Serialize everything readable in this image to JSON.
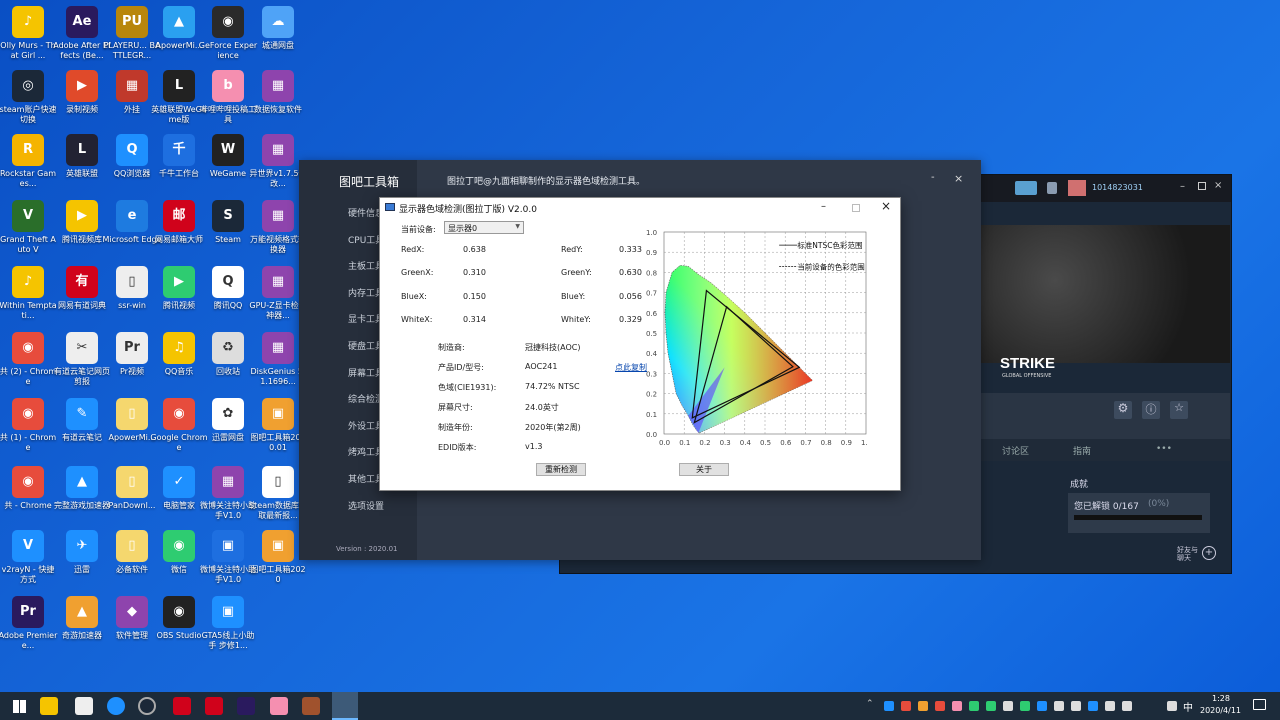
{
  "desktop_icons": [
    {
      "label": "Olly Murs - That Girl ...",
      "color": "#f5c400",
      "glyph": "♪"
    },
    {
      "label": "Adobe After Effects (Be...",
      "color": "#2a1a5e",
      "glyph": "Ae"
    },
    {
      "label": "PLAYERU... BATTLEGR...",
      "color": "#b8860b",
      "glyph": "PU"
    },
    {
      "label": "ApowerMi...",
      "color": "#2aa0f0",
      "glyph": "▲"
    },
    {
      "label": "GeForce Experience",
      "color": "#2a2a2a",
      "glyph": "◉"
    },
    {
      "label": "城通网盘",
      "color": "#4fa3f7",
      "glyph": "☁"
    },
    {
      "label": "steam账户快速切换",
      "color": "#1b2838",
      "glyph": "◎"
    },
    {
      "label": "录制视频",
      "color": "#e04a2a",
      "glyph": "▶"
    },
    {
      "label": "外挂",
      "color": "#c0392b",
      "glyph": "▦"
    },
    {
      "label": "英雄联盟WeGame版",
      "color": "#222",
      "glyph": "L"
    },
    {
      "label": "哔哩哔哩投稿工具",
      "color": "#f58fb0",
      "glyph": "b"
    },
    {
      "label": "数据恢复软件",
      "color": "#8e44ad",
      "glyph": "▦"
    },
    {
      "label": "Rockstar Games...",
      "color": "#f5b400",
      "glyph": "R"
    },
    {
      "label": "英雄联盟",
      "color": "#223",
      "glyph": "L"
    },
    {
      "label": "QQ浏览器",
      "color": "#1e90ff",
      "glyph": "Q"
    },
    {
      "label": "千牛工作台",
      "color": "#1e6fe0",
      "glyph": "千"
    },
    {
      "label": "WeGame",
      "color": "#222",
      "glyph": "W"
    },
    {
      "label": "异世界v1.7.5修改...",
      "color": "#8e44ad",
      "glyph": "▦"
    },
    {
      "label": "Grand Theft Auto V",
      "color": "#2a6e2a",
      "glyph": "V"
    },
    {
      "label": "腾讯视频库",
      "color": "#f5c400",
      "glyph": "▶"
    },
    {
      "label": "Microsoft Edge",
      "color": "#1e7be0",
      "glyph": "e"
    },
    {
      "label": "网易邮箱大师",
      "color": "#d0021b",
      "glyph": "邮"
    },
    {
      "label": "Steam",
      "color": "#1b2838",
      "glyph": "S"
    },
    {
      "label": "万能视频格式转换器",
      "color": "#8e44ad",
      "glyph": "▦"
    },
    {
      "label": "Within Temptati...",
      "color": "#f5c400",
      "glyph": "♪"
    },
    {
      "label": "网易有道词典",
      "color": "#d0021b",
      "glyph": "有"
    },
    {
      "label": "ssr-win",
      "color": "#eee",
      "glyph": "▯"
    },
    {
      "label": "腾讯视频",
      "color": "#2ecc71",
      "glyph": "▶"
    },
    {
      "label": "腾讯QQ",
      "color": "#fff",
      "glyph": "Q"
    },
    {
      "label": "GPU-Z显卡检测神器...",
      "color": "#8e44ad",
      "glyph": "▦"
    },
    {
      "label": "共 (2) - Chrome",
      "color": "#e74c3c",
      "glyph": "◉"
    },
    {
      "label": "有道云笔记网页剪报",
      "color": "#eee",
      "glyph": "✂"
    },
    {
      "label": "Pr视频",
      "color": "#eee",
      "glyph": "Pr"
    },
    {
      "label": "QQ音乐",
      "color": "#f5c400",
      "glyph": "♫"
    },
    {
      "label": "回收站",
      "color": "#ddd",
      "glyph": "♻"
    },
    {
      "label": "DiskGenius 5.1.1696...",
      "color": "#8e44ad",
      "glyph": "▦"
    },
    {
      "label": "共 (1) - Chrome",
      "color": "#e74c3c",
      "glyph": "◉"
    },
    {
      "label": "有道云笔记",
      "color": "#1e90ff",
      "glyph": "✎"
    },
    {
      "label": "ApowerMi...",
      "color": "#f5d76e",
      "glyph": "▯"
    },
    {
      "label": "Google Chrome",
      "color": "#e74c3c",
      "glyph": "◉"
    },
    {
      "label": "迅雷网盘",
      "color": "#fff",
      "glyph": "✿"
    },
    {
      "label": "图吧工具箱2020.01",
      "color": "#f0a030",
      "glyph": "▣"
    },
    {
      "label": "共 - Chrome",
      "color": "#e74c3c",
      "glyph": "◉"
    },
    {
      "label": "完整游戏加速器",
      "color": "#1e90ff",
      "glyph": "▲"
    },
    {
      "label": "PanDownl...",
      "color": "#f5d76e",
      "glyph": "▯"
    },
    {
      "label": "电脑管家",
      "color": "#1e90ff",
      "glyph": "✓"
    },
    {
      "label": "微博关注特小助手V1.0",
      "color": "#8e44ad",
      "glyph": "▦"
    },
    {
      "label": "Steam数据库获取最新报...",
      "color": "#fff",
      "glyph": "▯"
    },
    {
      "label": "v2rayN - 快捷方式",
      "color": "#1e90ff",
      "glyph": "V"
    },
    {
      "label": "迅雷",
      "color": "#1e90ff",
      "glyph": "✈"
    },
    {
      "label": "必备软件",
      "color": "#f5d76e",
      "glyph": "▯"
    },
    {
      "label": "微信",
      "color": "#2ecc71",
      "glyph": "◉"
    },
    {
      "label": "微博关注特小助手V1.0",
      "color": "#1e6fe0",
      "glyph": "▣"
    },
    {
      "label": "图吧工具箱2020",
      "color": "#f0a030",
      "glyph": "▣"
    },
    {
      "label": "Adobe Premiere...",
      "color": "#2a1a5e",
      "glyph": "Pr"
    },
    {
      "label": "奇游加速器",
      "color": "#f0a030",
      "glyph": "▲"
    },
    {
      "label": "软件管理",
      "color": "#8e44ad",
      "glyph": "◆"
    },
    {
      "label": "OBS Studio",
      "color": "#222",
      "glyph": "◉"
    },
    {
      "label": "GTA5线上小助手 步修1...",
      "color": "#1e90ff",
      "glyph": "▣"
    }
  ],
  "steam": {
    "username": "1014823031",
    "game_logo": "STRIKE",
    "game_sub": "GLOBAL OFFENSIVE",
    "tab_discussion": "讨论区",
    "tab_guide": "指南",
    "tab_more": "•••",
    "achievements_title": "成就",
    "achievements_text": "您已解锁 0/167",
    "achievements_pct": "(0%)",
    "achievements_progress": 0,
    "friends_label": "好友与聊天"
  },
  "toolbox": {
    "title": "图吧工具箱",
    "header": "图拉丁吧@九面相聊制作的显示器色域检测工具。",
    "nav": [
      "硬件信息",
      "CPU工具",
      "主板工具",
      "内存工具",
      "显卡工具",
      "硬盘工具",
      "屏幕工具",
      "综合检测",
      "外设工具",
      "烤鸡工具",
      "其他工具",
      "选项设置"
    ],
    "version": "Version : 2020.01",
    "min_label": "-",
    "close_label": "×"
  },
  "dialog": {
    "title": "显示器色域检测(图拉丁版) V2.0.0",
    "device_label": "当前设备:",
    "device_value": "显示器0",
    "redx_label": "RedX:",
    "redx": "0.638",
    "redy_label": "RedY:",
    "redy": "0.333",
    "greenx_label": "GreenX:",
    "greenx": "0.310",
    "greeny_label": "GreenY:",
    "greeny": "0.630",
    "bluex_label": "BlueX:",
    "bluex": "0.150",
    "bluey_label": "BlueY:",
    "bluey": "0.056",
    "whitex_label": "WhiteX:",
    "whitex": "0.314",
    "whitey_label": "WhiteY:",
    "whitey": "0.329",
    "mfr_label": "制造商:",
    "mfr": "冠捷科技(AOC)",
    "model_label": "产品ID/型号:",
    "model": "AOC241",
    "copy_link": "点此复制",
    "gamut_label": "色域(CIE1931):",
    "gamut": "74.72% NTSC",
    "size_label": "屏幕尺寸:",
    "size": "24.0英寸",
    "year_label": "制造年份:",
    "year": "2020年(第2周)",
    "edid_label": "EDID版本:",
    "edid": "v1.3",
    "redetect": "重新检测",
    "about": "关于",
    "legend_ntsc": "标准NTSC色彩范围",
    "legend_dev": "当前设备的色彩范围",
    "x_ticks": [
      "0.0",
      "0.1",
      "0.2",
      "0.3",
      "0.4",
      "0.5",
      "0.6",
      "0.7",
      "0.8",
      "0.9",
      "1."
    ],
    "y_ticks": [
      "1.0",
      "0.9",
      "0.8",
      "0.7",
      "0.6",
      "0.5",
      "0.4",
      "0.3",
      "0.2",
      "0.1",
      "0.0"
    ]
  },
  "chart_data": {
    "type": "scatter",
    "xlim": [
      0,
      1
    ],
    "ylim": [
      0,
      1
    ],
    "grid": true,
    "legend_position": "top-right",
    "series": [
      {
        "name": "标准NTSC色彩范围",
        "points": [
          [
            0.67,
            0.33
          ],
          [
            0.21,
            0.71
          ],
          [
            0.14,
            0.08
          ]
        ]
      },
      {
        "name": "当前设备的色彩范围",
        "points": [
          [
            0.638,
            0.333
          ],
          [
            0.31,
            0.63
          ],
          [
            0.15,
            0.056
          ]
        ]
      }
    ]
  },
  "taskbar": {
    "time": "1:28",
    "date": "2020/4/11",
    "ime": "中"
  }
}
